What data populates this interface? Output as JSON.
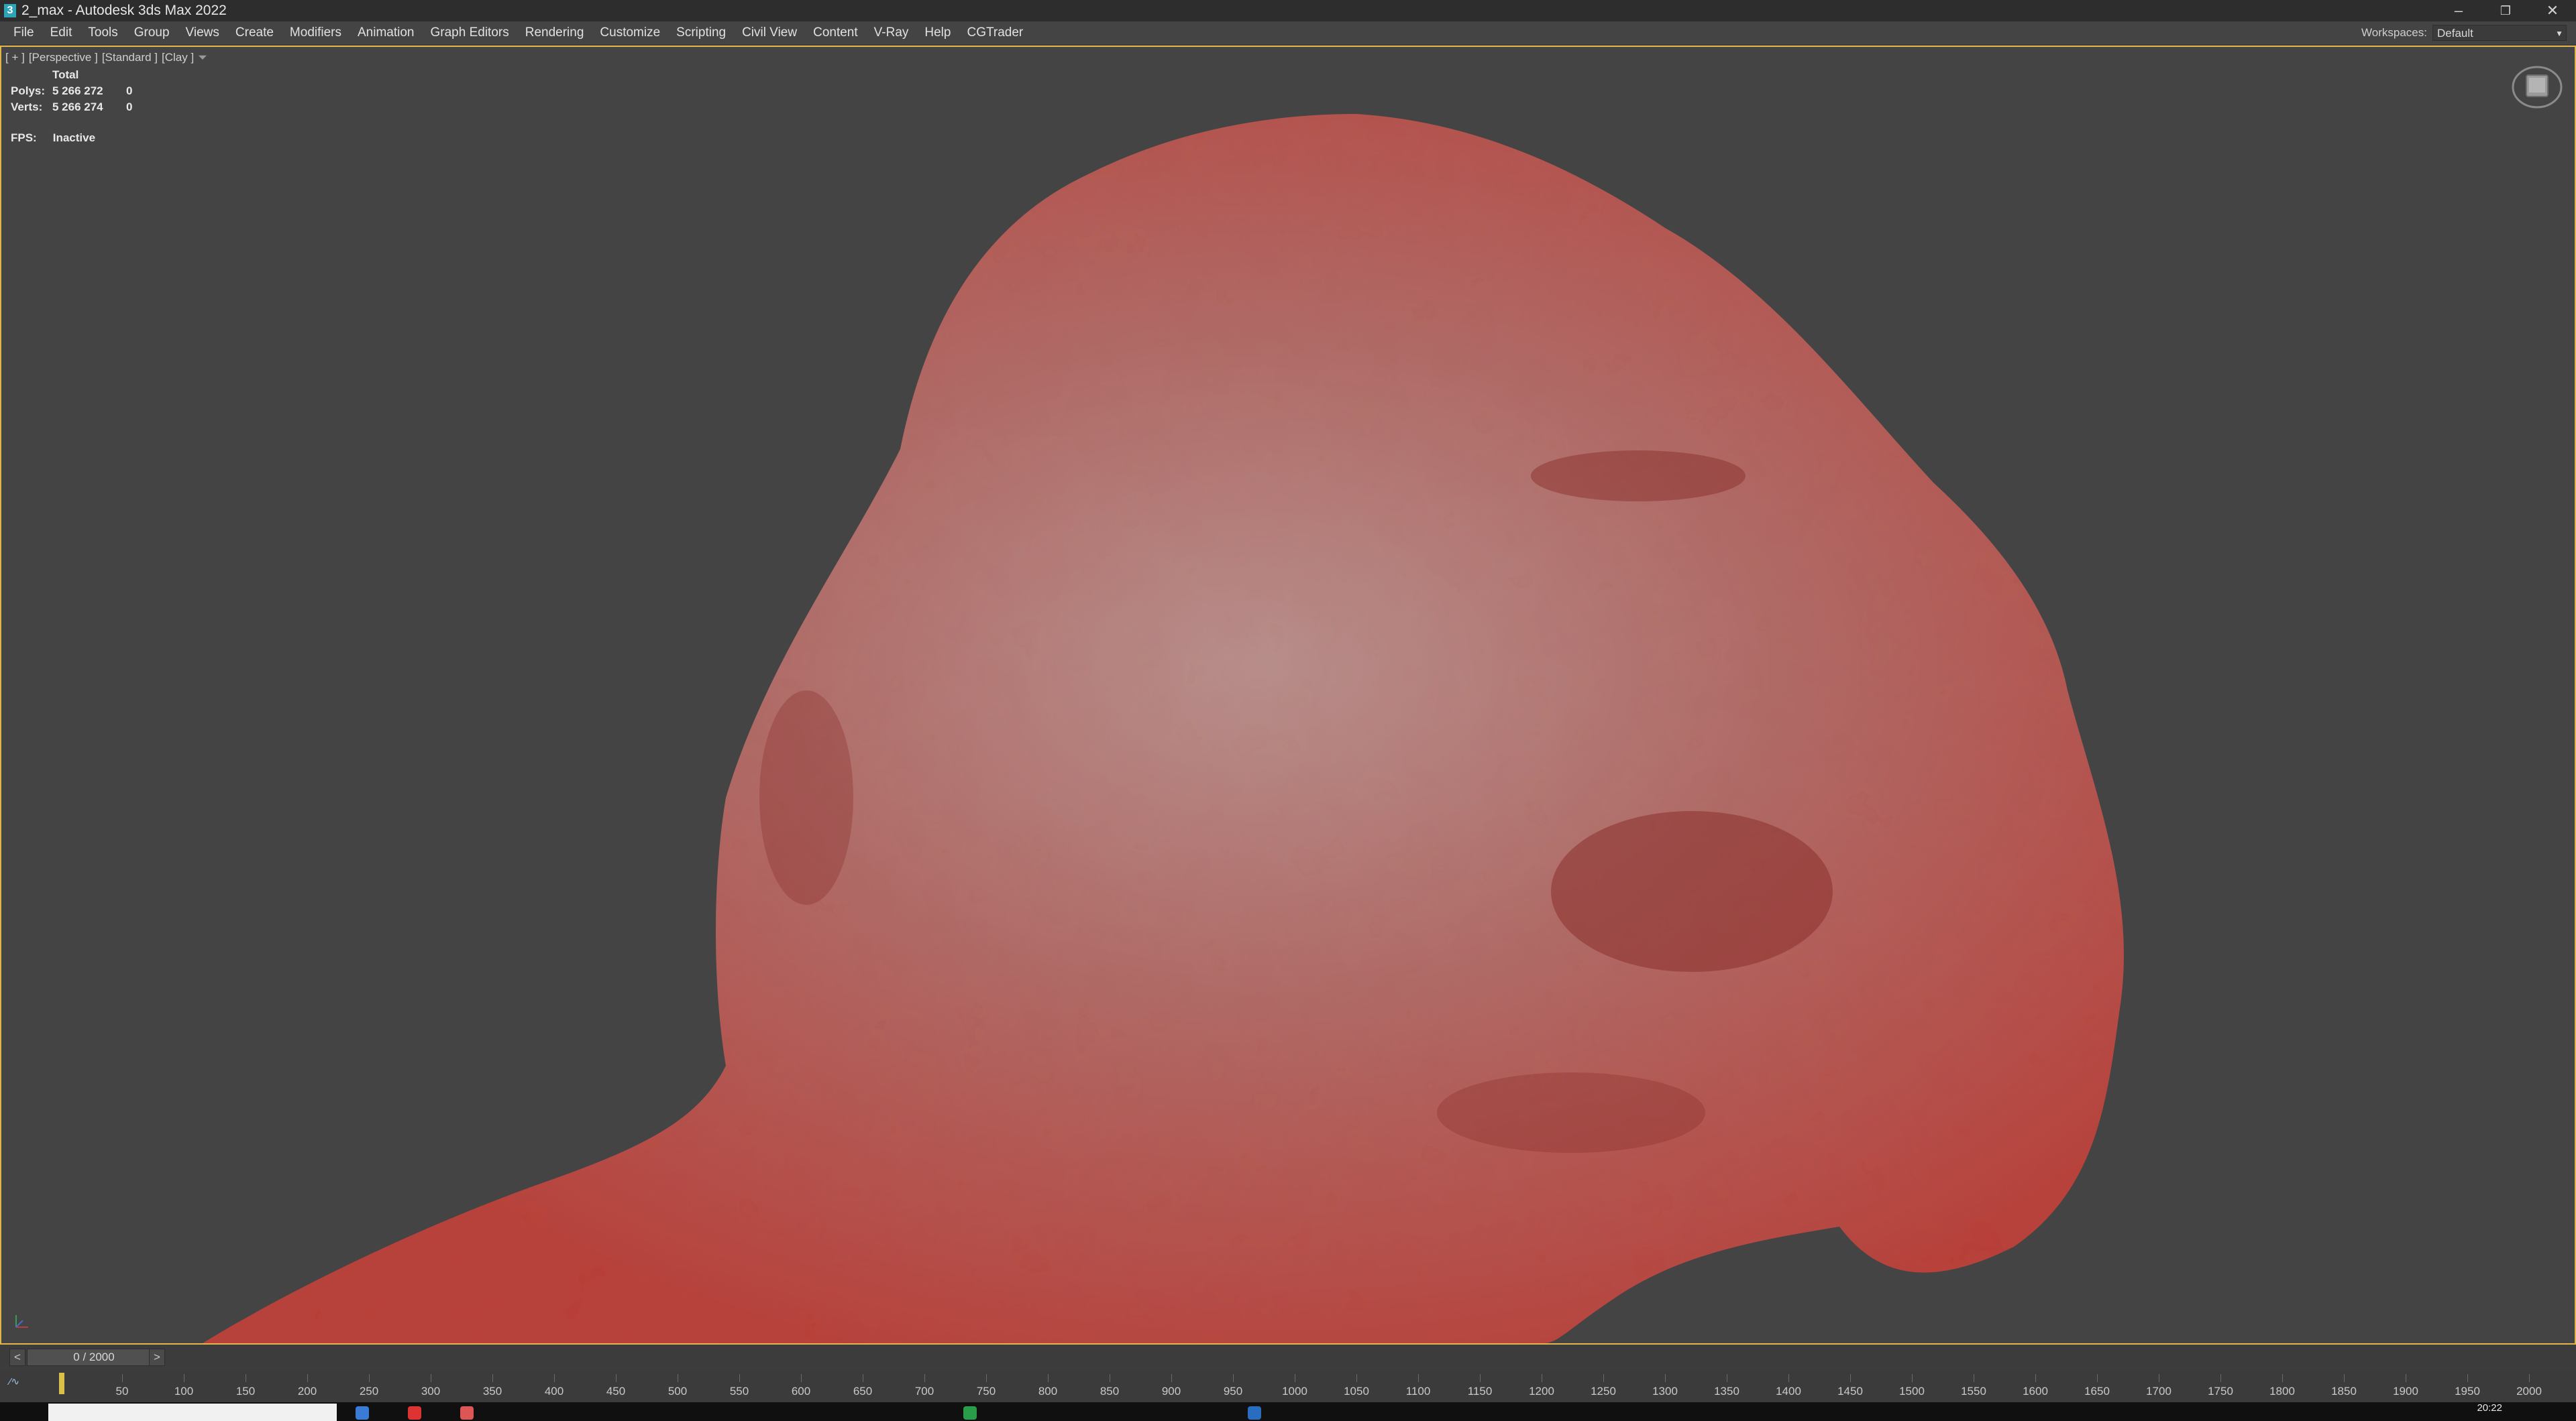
{
  "window": {
    "title": "2_max - Autodesk 3ds Max 2022",
    "app_icon_glyph": "3",
    "controls": {
      "minimize": "–",
      "restore": "❐",
      "close": "✕"
    }
  },
  "menu": {
    "items": [
      "File",
      "Edit",
      "Tools",
      "Group",
      "Views",
      "Create",
      "Modifiers",
      "Animation",
      "Graph Editors",
      "Rendering",
      "Customize",
      "Scripting",
      "Civil View",
      "Content",
      "V-Ray",
      "Help",
      "CGTrader"
    ],
    "workspaces_label": "Workspaces:",
    "workspaces_value": "Default"
  },
  "viewport": {
    "label_parts": [
      "[ + ]",
      "[Perspective ]",
      "[Standard ]",
      "[Clay ]"
    ],
    "filter_icon": "filter-icon",
    "stats": {
      "header": "Total",
      "polys_label": "Polys:",
      "polys_value": "5 266 272",
      "polys_sel": "0",
      "verts_label": "Verts:",
      "verts_value": "5 266 274",
      "verts_sel": "0"
    },
    "fps_label": "FPS:",
    "fps_value": "Inactive",
    "object_color": "#c0524b",
    "background_color": "#444444"
  },
  "timeline": {
    "prev_label": "<",
    "slider_label": "0 / 2000",
    "next_label": ">",
    "tick_labels": [
      "50",
      "100",
      "150",
      "200",
      "250",
      "300",
      "350",
      "400",
      "450",
      "500",
      "550",
      "600",
      "650",
      "700",
      "750",
      "800",
      "850",
      "900",
      "950",
      "1000",
      "1050",
      "1100",
      "1150",
      "1200",
      "1250",
      "1300",
      "1350",
      "1400",
      "1450",
      "1500",
      "1550",
      "1600",
      "1650",
      "1700",
      "1750",
      "1800",
      "1850",
      "1900",
      "1950",
      "2000"
    ],
    "max_frame": 2000,
    "current_frame": 0
  },
  "taskbar": {
    "clock": "20:22"
  }
}
